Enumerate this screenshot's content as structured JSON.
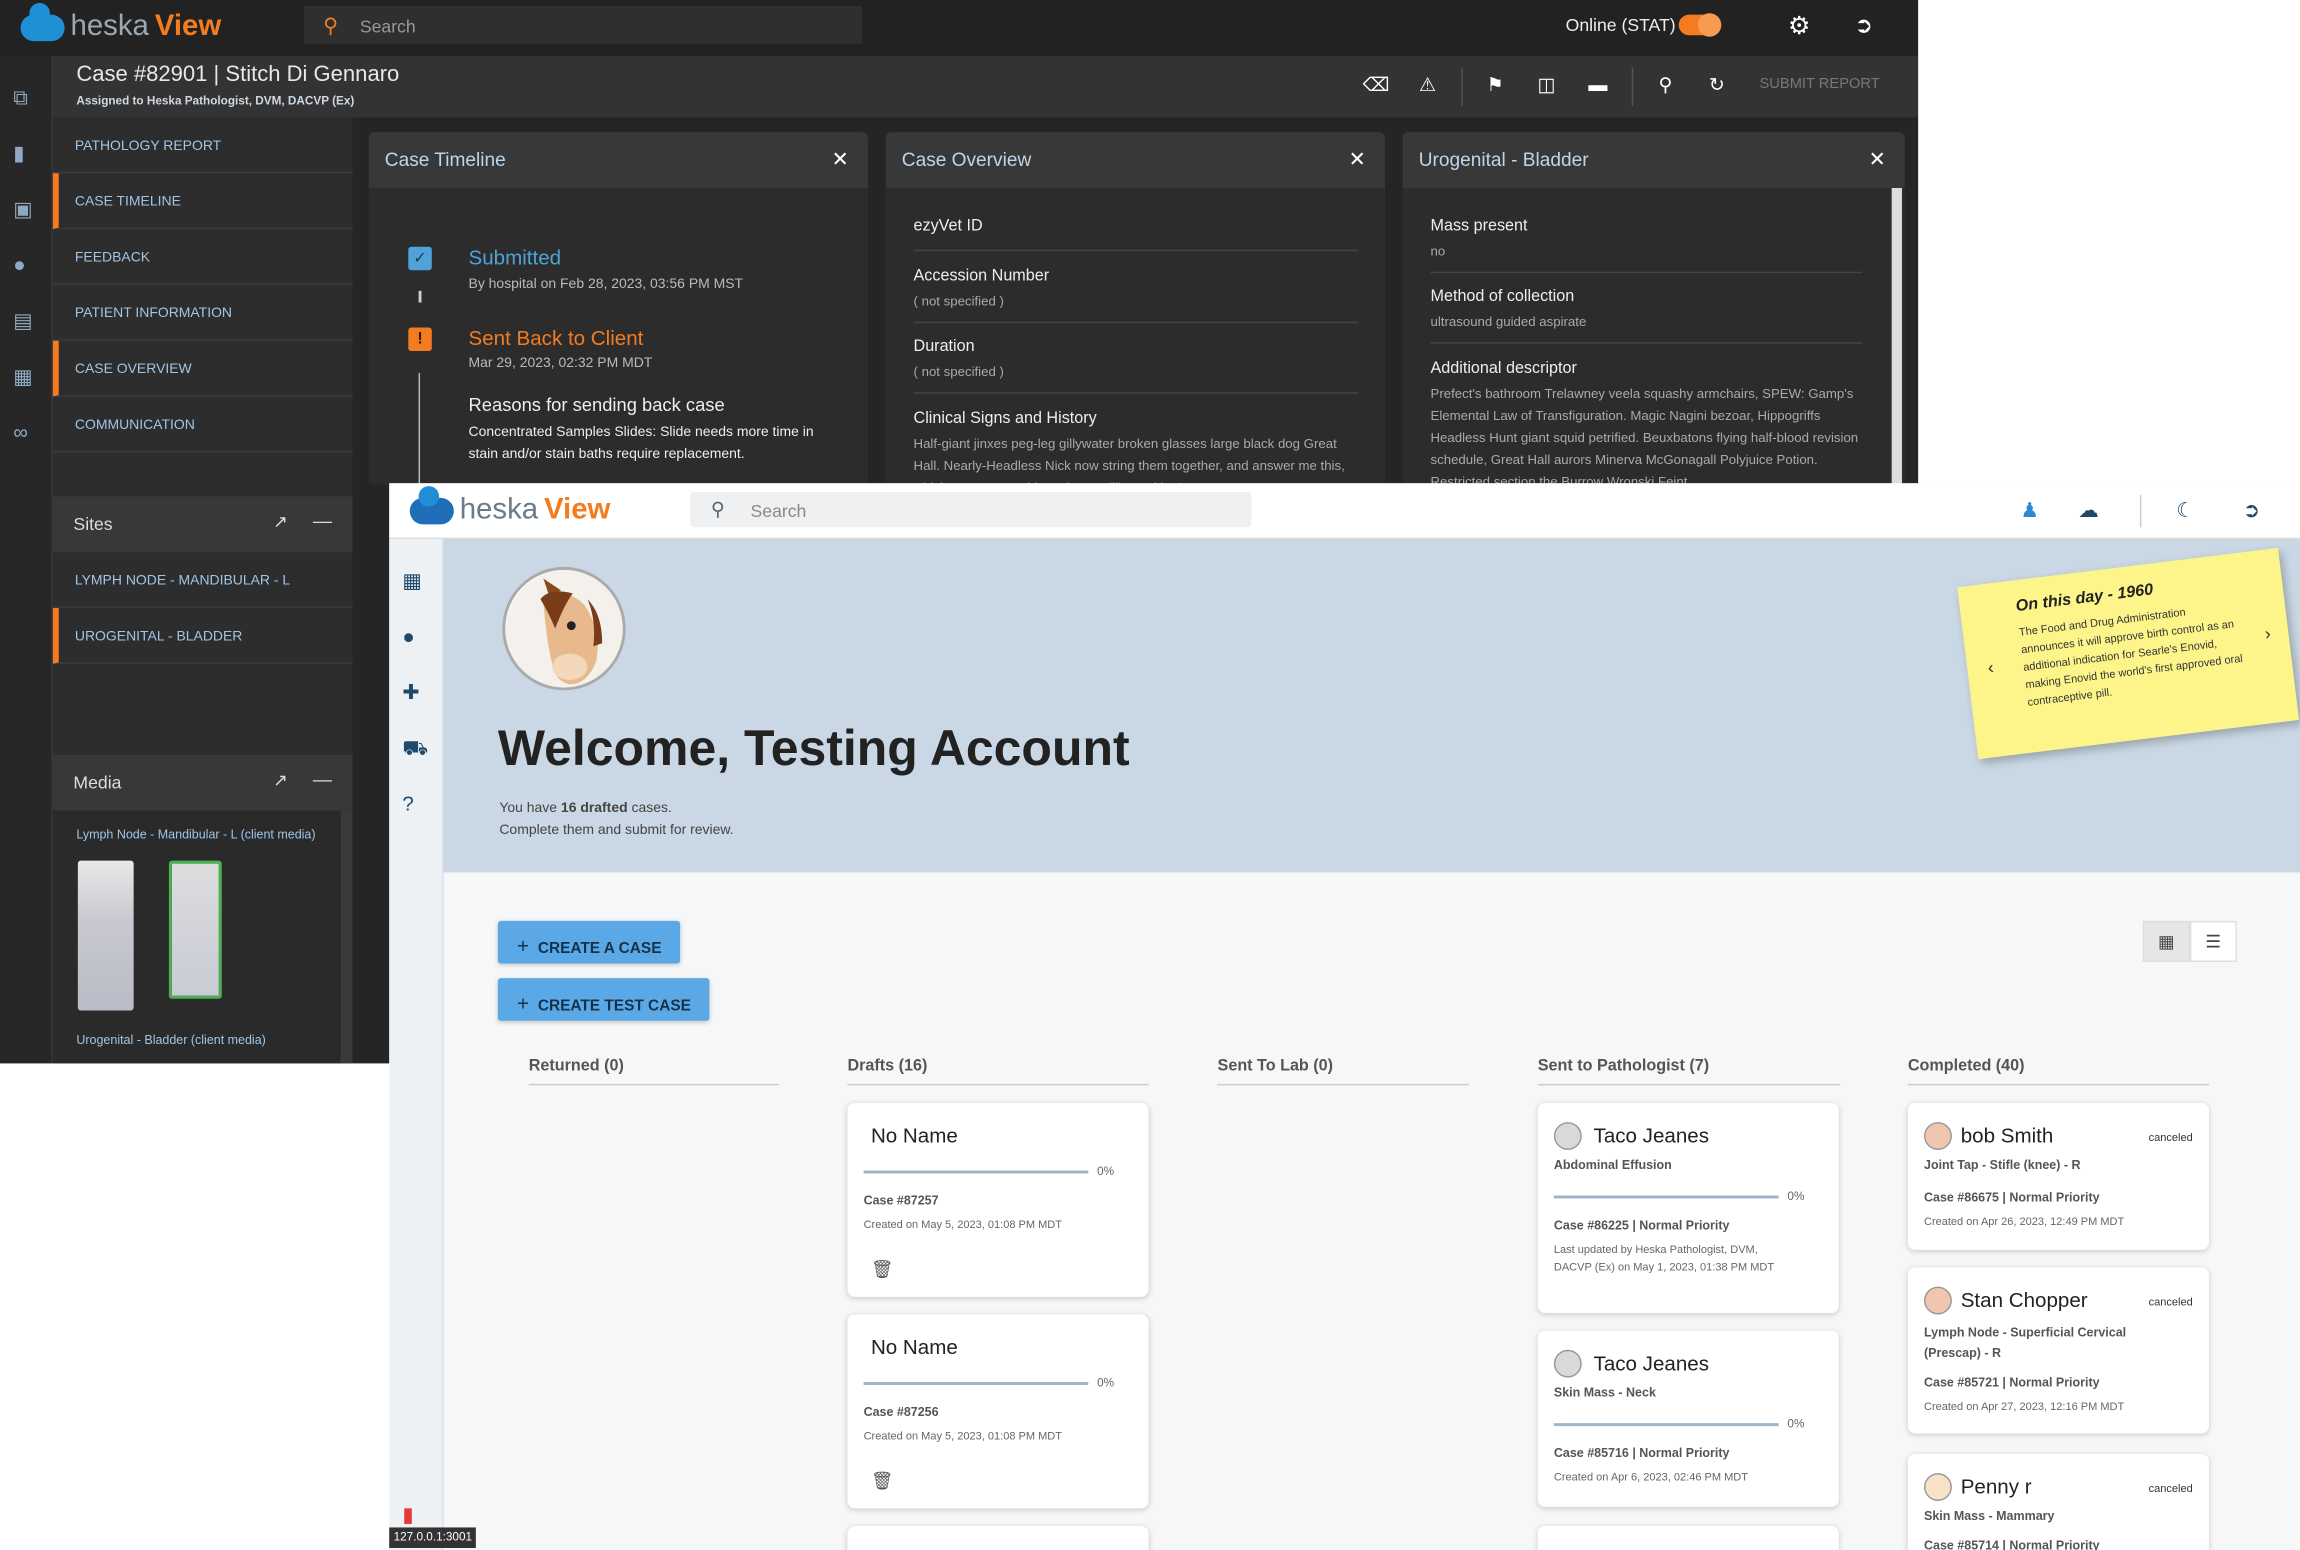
{
  "dark": {
    "logo_main": "heska",
    "logo_accent": "View",
    "search_placeholder": "Search",
    "online_label": "Online (STAT)",
    "case_title": "Case #82901  |  Stitch Di Gennaro",
    "assigned": "Assigned to Heska Pathologist, DVM, DACVP (Ex)",
    "submit_label": "SUBMIT REPORT",
    "nav": [
      {
        "label": "PATHOLOGY REPORT",
        "active": false
      },
      {
        "label": "CASE TIMELINE",
        "active": true
      },
      {
        "label": "FEEDBACK",
        "active": false
      },
      {
        "label": "PATIENT INFORMATION",
        "active": false
      },
      {
        "label": "CASE OVERVIEW",
        "active": true
      },
      {
        "label": "COMMUNICATION",
        "active": false
      }
    ],
    "sites_title": "Sites",
    "sites": [
      {
        "label": "LYMPH NODE - MANDIBULAR - L",
        "active": false
      },
      {
        "label": "UROGENITAL - BLADDER",
        "active": true
      }
    ],
    "media_title": "Media",
    "media_group1": "Lymph Node - Mandibular - L (client media)",
    "media_group2": "Urogenital - Bladder (client media)",
    "timeline": {
      "title": "Case Timeline",
      "submitted": "Submitted",
      "submitted_meta": "By hospital on Feb 28, 2023, 03:56 PM MST",
      "sent_back": "Sent Back to Client",
      "sent_back_meta": "Mar 29, 2023, 02:32 PM MDT",
      "reasons_title": "Reasons for sending back case",
      "reasons_text": "Concentrated Samples Slides: Slide needs more time in stain and/or stain baths require replacement."
    },
    "overview": {
      "title": "Case Overview",
      "rows": [
        {
          "label": "ezyVet ID",
          "value": ""
        },
        {
          "label": "Accession Number",
          "value": "( not specified )"
        },
        {
          "label": "Duration",
          "value": "( not specified )"
        },
        {
          "label": "Clinical Signs and History",
          "value": "Half-giant jinxes peg-leg gillywater broken glasses large black dog Great Hall. Nearly-Headless Nick now string them together, and answer me this, which creature would you be unwilling to kiss?"
        }
      ]
    },
    "bladder": {
      "title": "Urogenital - Bladder",
      "rows": [
        {
          "label": "Mass present",
          "value": "no"
        },
        {
          "label": "Method of collection",
          "value": "ultrasound guided aspirate"
        },
        {
          "label": "Additional descriptor",
          "value": "Prefect's bathroom Trelawney veela squashy armchairs, SPEW: Gamp's Elemental Law of Transfiguration. Magic Nagini bezoar, Hippogriffs Headless Hunt giant squid petrified. Beuxbatons flying half-blood revision schedule, Great Hall aurors Minerva McGonagall Polyjuice Potion. Restricted section the Burrow Wronski Feint."
        }
      ]
    }
  },
  "light": {
    "logo_main": "heska",
    "logo_accent": "View",
    "search_placeholder": "Search",
    "welcome": "Welcome, Testing Account",
    "drafted_prefix": "You have ",
    "drafted_count": "16 drafted",
    "drafted_suffix": " cases.",
    "drafted_line2": "Complete them and submit for review.",
    "sticky": {
      "title": "On this day - 1960",
      "text": "The Food and Drug Administration announces it will approve birth control as an additional indication for Searle's Enovid, making Enovid the world's first approved oral contraceptive pill."
    },
    "create_case": "CREATE A CASE",
    "create_test_case": "CREATE TEST CASE",
    "columns": [
      {
        "title": "Returned (0)"
      },
      {
        "title": "Drafts (16)"
      },
      {
        "title": "Sent To Lab (0)"
      },
      {
        "title": "Sent to Pathologist (7)"
      },
      {
        "title": "Completed (40)"
      }
    ],
    "drafts": [
      {
        "name": "No Name",
        "pct": "0%",
        "progress": 0,
        "case": "Case #87257",
        "created": "Created on May 5, 2023, 01:08 PM MDT"
      },
      {
        "name": "No Name",
        "pct": "0%",
        "progress": 0,
        "case": "Case #87256",
        "created": "Created on May 5, 2023, 01:08 PM MDT"
      }
    ],
    "pathologist": [
      {
        "name": "Taco Jeanes",
        "site": "Abdominal Effusion",
        "pct": "0%",
        "case": "Case #86225 | Normal Priority",
        "meta": "Last updated by Heska Pathologist, DVM, DACVP (Ex) on May 1, 2023, 01:38 PM MDT"
      },
      {
        "name": "Taco Jeanes",
        "site": "Skin Mass - Neck",
        "pct": "0%",
        "case": "Case #85716 | Normal Priority",
        "meta": "Created on Apr 6, 2023, 02:46 PM MDT"
      }
    ],
    "completed": [
      {
        "name": "bob Smith",
        "status": "canceled",
        "site": "Joint Tap - Stifle (knee) - R",
        "case": "Case #86675 | Normal Priority",
        "meta": "Created on Apr 26, 2023, 12:49 PM MDT"
      },
      {
        "name": "Stan Chopper",
        "status": "canceled",
        "site": "Lymph Node - Superficial Cervical (Prescap) - R",
        "case": "Case #85721 | Normal Priority",
        "meta": "Created on Apr 27, 2023, 12:16 PM MDT"
      },
      {
        "name": "Penny r",
        "status": "canceled",
        "site": "Skin Mass - Mammary",
        "case": "Case #85714 | Normal Priority",
        "meta": ""
      }
    ],
    "status_url": "127.0.0.1:3001"
  }
}
